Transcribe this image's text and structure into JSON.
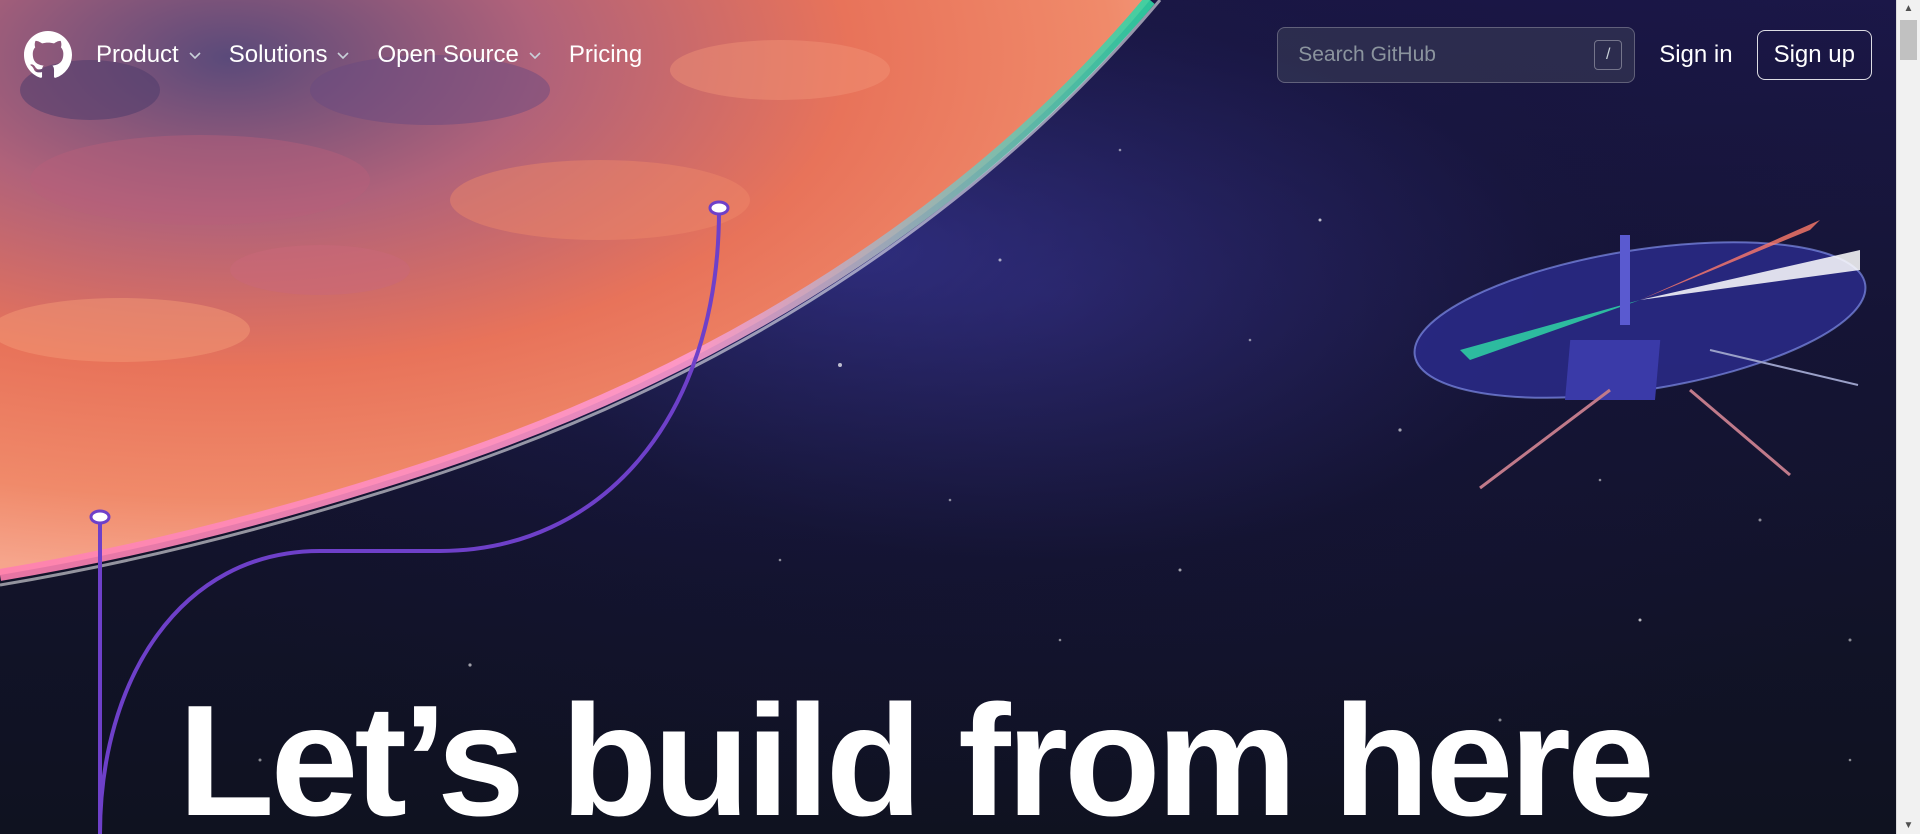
{
  "header": {
    "logo_name": "github-mark-icon",
    "nav": [
      {
        "label": "Product",
        "has_dropdown": true
      },
      {
        "label": "Solutions",
        "has_dropdown": true
      },
      {
        "label": "Open Source",
        "has_dropdown": true
      },
      {
        "label": "Pricing",
        "has_dropdown": false
      }
    ],
    "search": {
      "placeholder": "Search GitHub",
      "shortcut": "/"
    },
    "sign_in_label": "Sign in",
    "sign_up_label": "Sign up"
  },
  "hero": {
    "headline": "Let’s build from here"
  },
  "colors": {
    "background": "#0d1117",
    "planet": "#e8735a",
    "connector_line": "#6e40c9",
    "text": "#ffffff"
  }
}
